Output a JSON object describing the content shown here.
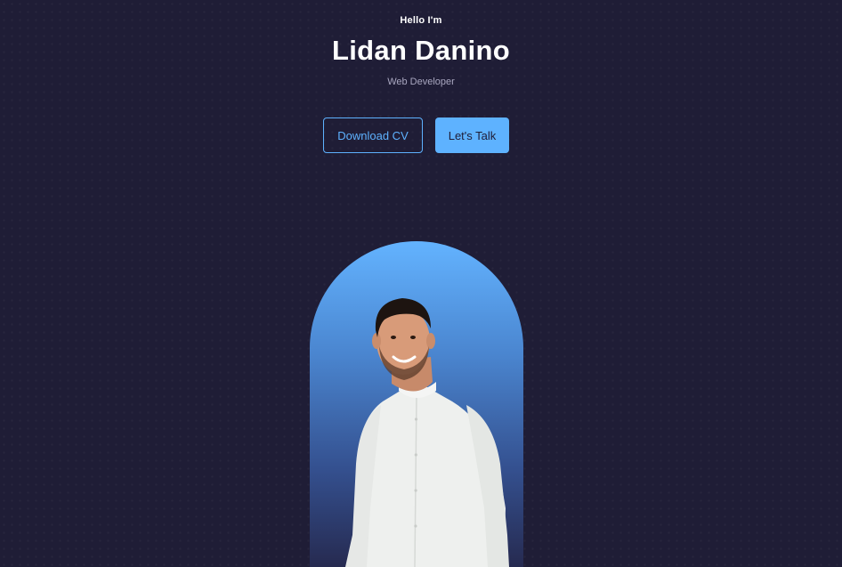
{
  "hero": {
    "greeting": "Hello I'm",
    "name": "Lidan Danino",
    "role": "Web Developer"
  },
  "actions": {
    "download_label": "Download CV",
    "talk_label": "Let's Talk"
  },
  "colors": {
    "background": "#1f1d36",
    "accent": "#5eb2ff",
    "muted_text": "#a9a7c0"
  },
  "portrait": {
    "icon": "profile-photo"
  }
}
